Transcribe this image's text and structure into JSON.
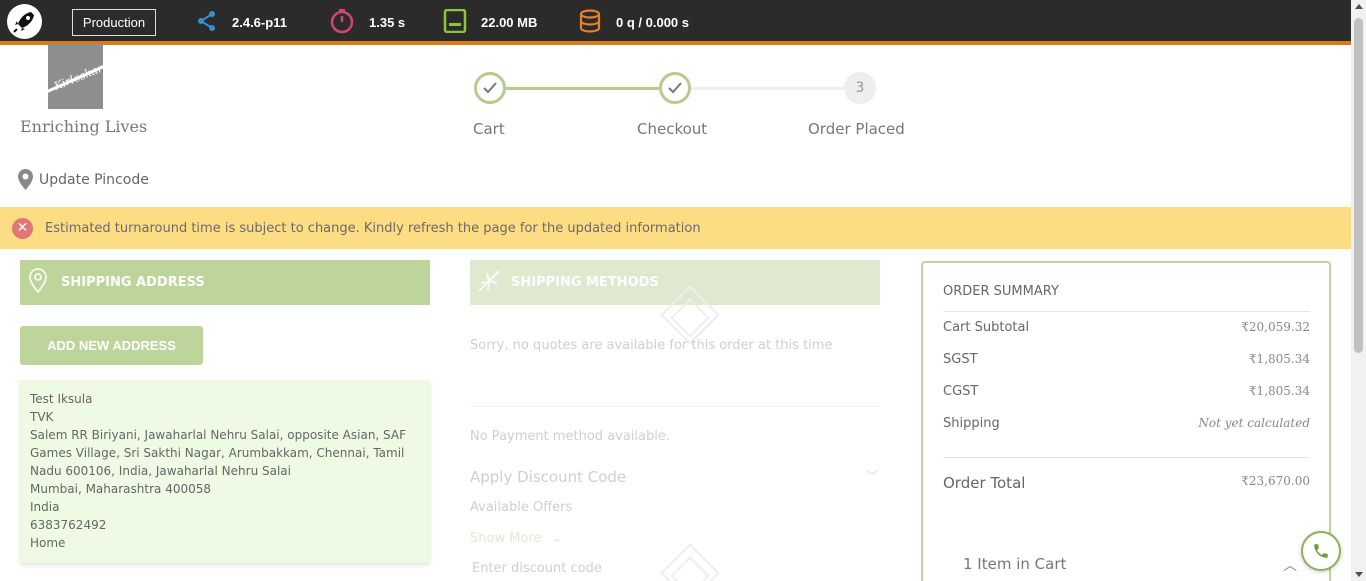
{
  "debugbar": {
    "environment": "Production",
    "version": "2.4.6-p11",
    "time": "1.35 s",
    "memory": "22.00 MB",
    "queries": "0 q / 0.000 s",
    "colors": {
      "bg": "#2b2b2b",
      "accent": "#d87c1a"
    }
  },
  "header": {
    "logo_text": "Kirloskar",
    "tagline": "Enriching Lives",
    "steps": [
      {
        "label": "Cart",
        "state": "done"
      },
      {
        "label": "Checkout",
        "state": "done"
      },
      {
        "number": "3",
        "label": "Order Placed",
        "state": "todo"
      }
    ],
    "pincode_label": "Update Pincode"
  },
  "alert": {
    "text": "Estimated turnaround time is subject to change. Kindly refresh the page for the updated information",
    "icon": "close-circle-icon"
  },
  "shipping_address": {
    "title": "SHIPPING ADDRESS",
    "add_button": "ADD NEW ADDRESS",
    "address_lines": [
      "Test Iksula",
      "TVK",
      "Salem RR Biriyani, Jawaharlal Nehru Salai, opposite Asian, SAF",
      "Games Village, Sri Sakthi Nagar, Arumbakkam, Chennai, Tamil",
      "Nadu 600106, India, Jawaharlal Nehru Salai",
      "Mumbai, Maharashtra 400058",
      "India",
      "6383762492",
      "Home"
    ]
  },
  "shipping_methods": {
    "title": "SHIPPING METHODS",
    "no_quotes": "Sorry, no quotes are available for this order at this time",
    "no_payment": "No Payment method available.",
    "discount_title": "Apply Discount Code",
    "available_offers": "Available Offers",
    "show_more": "Show More",
    "discount_placeholder": "Enter discount code"
  },
  "order_summary": {
    "title": "ORDER SUMMARY",
    "rows": [
      {
        "label": "Cart Subtotal",
        "value": "₹20,059.32"
      },
      {
        "label": "SGST",
        "value": "₹1,805.34"
      },
      {
        "label": "CGST",
        "value": "₹1,805.34"
      },
      {
        "label": "Shipping",
        "value": "Not yet calculated"
      }
    ],
    "total_label": "Order Total",
    "total_value": "₹23,670.00",
    "items_in_cart": "1 Item in Cart"
  },
  "theme": {
    "green": "#bdd49b",
    "alert_bg": "#fddd83"
  }
}
